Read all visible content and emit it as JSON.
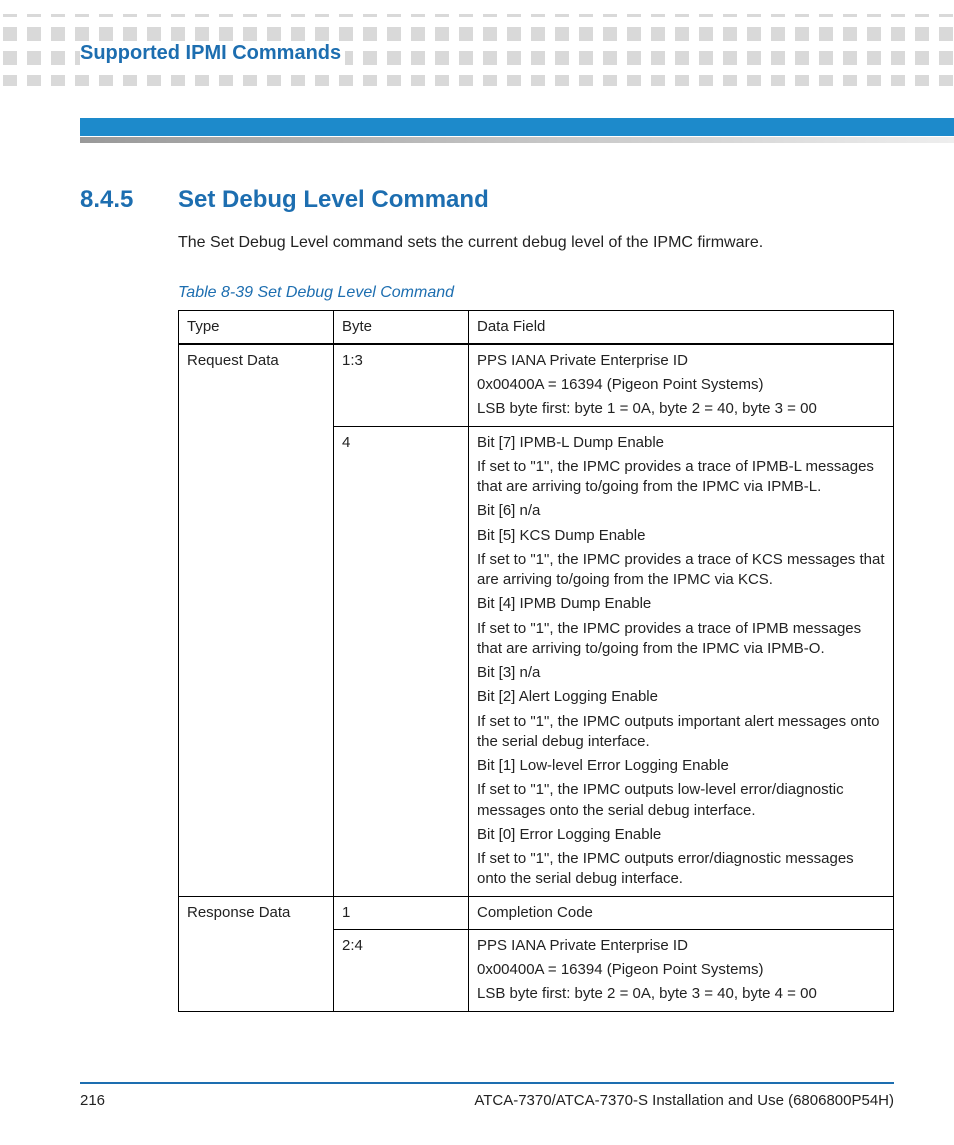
{
  "chapter_title": "Supported IPMI Commands",
  "section": {
    "number": "8.4.5",
    "title": "Set Debug Level Command",
    "intro": "The Set Debug Level command sets the current debug level of the IPMC firmware."
  },
  "table": {
    "caption": "Table 8-39 Set Debug Level Command",
    "headers": {
      "type": "Type",
      "byte": "Byte",
      "data": "Data Field"
    },
    "rows": [
      {
        "type": "Request Data",
        "byte": "1:3",
        "data": [
          "PPS IANA Private Enterprise ID",
          "0x00400A = 16394 (Pigeon Point Systems)",
          "LSB byte first: byte 1 = 0A, byte 2 = 40, byte 3 = 00"
        ],
        "type_rowspan": 2
      },
      {
        "byte": "4",
        "data": [
          "Bit [7] IPMB-L Dump Enable",
          "If set to \"1\", the IPMC provides a trace of IPMB-L messages that are arriving to/going from the IPMC via IPMB-L.",
          "Bit [6] n/a",
          "Bit [5] KCS Dump Enable",
          "If set to \"1\", the IPMC provides a trace of KCS messages that are arriving to/going from the IPMC via KCS.",
          "Bit [4] IPMB Dump Enable",
          "If set to \"1\", the IPMC provides a trace of IPMB messages that are arriving to/going from the IPMC via IPMB-O.",
          "Bit [3] n/a",
          "Bit [2] Alert Logging Enable",
          "If set to \"1\", the IPMC outputs important alert messages onto the serial debug interface.",
          "Bit [1] Low-level Error Logging Enable",
          "If set to \"1\", the IPMC outputs low-level error/diagnostic messages onto the serial debug interface.",
          "Bit [0] Error Logging Enable",
          "If set to \"1\", the IPMC outputs error/diagnostic messages onto the serial debug interface."
        ]
      },
      {
        "type": "Response Data",
        "byte": "1",
        "data": [
          "Completion Code"
        ],
        "type_rowspan": 2
      },
      {
        "byte": "2:4",
        "data": [
          "PPS IANA Private Enterprise ID",
          "0x00400A = 16394 (Pigeon Point Systems)",
          "LSB byte first: byte 2 = 0A, byte 3 = 40, byte 4 = 00"
        ]
      }
    ]
  },
  "footer": {
    "page": "216",
    "doc": "ATCA-7370/ATCA-7370-S Installation and Use (6806800P54H)"
  }
}
